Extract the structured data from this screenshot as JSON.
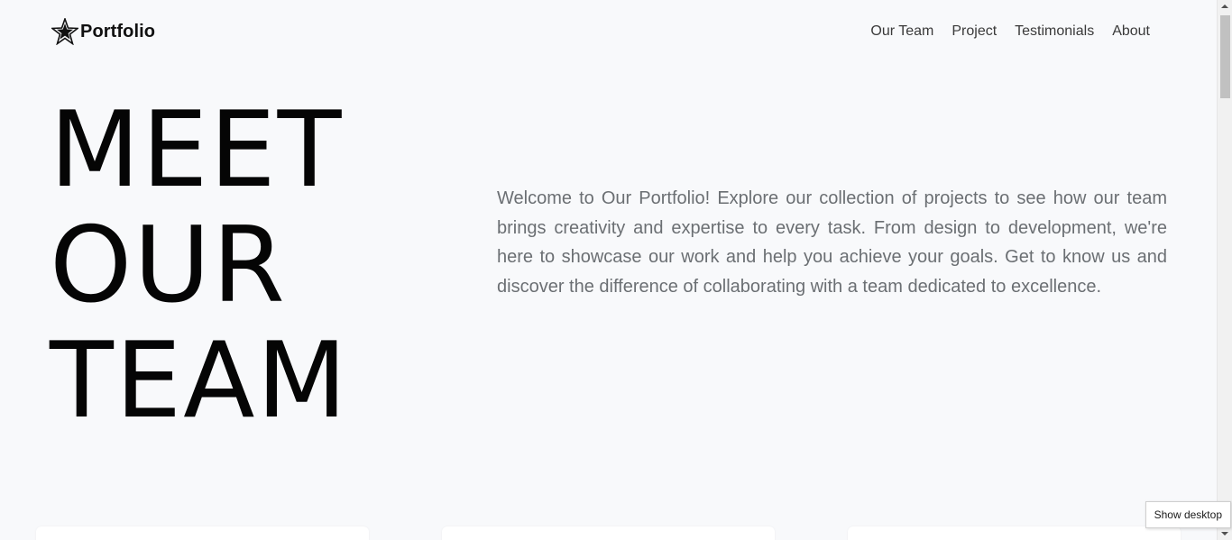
{
  "navbar": {
    "brand": "Portfolio",
    "links": [
      "Our Team",
      "Project",
      "Testimonials",
      "About"
    ]
  },
  "hero": {
    "title_lines": [
      "MEET",
      "OUR",
      "TEAM"
    ],
    "description": "Welcome to Our Portfolio! Explore our collection of projects to see how our team brings creativity and expertise to every task. From design to development, we're here to showcase our work and help you achieve your goals. Get to know us and discover the difference of collaborating with a team dedicated to excellence."
  },
  "tooltip": "Show desktop",
  "colors": {
    "background": "#f8f9fb",
    "text_primary": "#050505",
    "text_muted": "#6b6f73"
  },
  "icons": {
    "brand": "star-icon"
  }
}
